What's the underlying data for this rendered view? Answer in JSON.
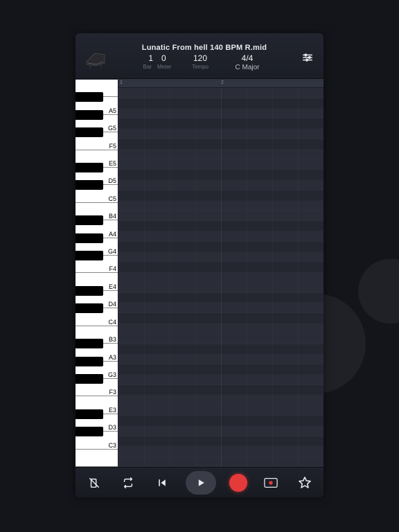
{
  "header": {
    "title": "Lunatic From hell 140 BPM R.mid",
    "bar": "1",
    "meter": "0",
    "bar_label": "Bar",
    "meter_label": "Meter",
    "tempo": "120",
    "tempo_label": "Tempo",
    "time_sig": "4/4",
    "key": "C Major"
  },
  "ruler": {
    "marks": [
      "1",
      "2"
    ]
  },
  "keys": {
    "white": [
      {
        "n": "",
        "top": false
      },
      {
        "n": "A5"
      },
      {
        "n": "G5"
      },
      {
        "n": "F5"
      },
      {
        "n": "E5"
      },
      {
        "n": "D5"
      },
      {
        "n": "C5"
      },
      {
        "n": "B4"
      },
      {
        "n": "A4"
      },
      {
        "n": "G4"
      },
      {
        "n": "F4"
      },
      {
        "n": "E4"
      },
      {
        "n": "D4"
      },
      {
        "n": "C4"
      },
      {
        "n": "B3"
      },
      {
        "n": "A3"
      },
      {
        "n": "G3"
      },
      {
        "n": "F3"
      },
      {
        "n": "E3"
      },
      {
        "n": "D3"
      },
      {
        "n": "C3"
      },
      {
        "n": ""
      }
    ]
  },
  "colors": {
    "bg": "#13151a",
    "panel": "#1c1f27",
    "record": "#e43a3a"
  }
}
